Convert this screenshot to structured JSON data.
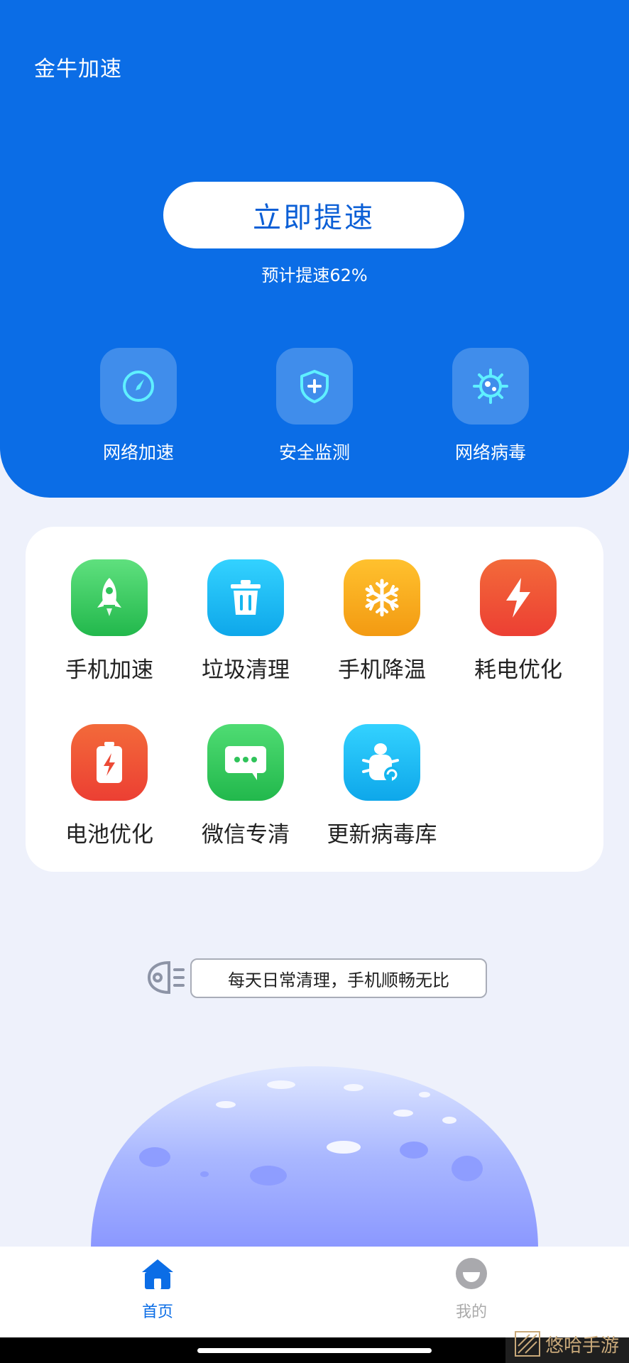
{
  "app": {
    "title": "金牛加速"
  },
  "boost": {
    "button_label": "立即提速",
    "estimate_text": "预计提速62%"
  },
  "quick_actions": [
    {
      "label": "网络加速",
      "icon": "compass-icon"
    },
    {
      "label": "安全监测",
      "icon": "shield-plus-icon"
    },
    {
      "label": "网络病毒",
      "icon": "virus-icon"
    }
  ],
  "tools": [
    {
      "label": "手机加速",
      "icon": "rocket-icon",
      "color": "#2fc35a"
    },
    {
      "label": "垃圾清理",
      "icon": "trash-icon",
      "color": "#14b6ef"
    },
    {
      "label": "手机降温",
      "icon": "snowflake-icon",
      "color": "#f7a41b"
    },
    {
      "label": "耗电优化",
      "icon": "lightning-icon",
      "color": "#f0503a"
    },
    {
      "label": "电池优化",
      "icon": "battery-icon",
      "color": "#f0503a"
    },
    {
      "label": "微信专清",
      "icon": "chat-icon",
      "color": "#2fc35a"
    },
    {
      "label": "更新病毒库",
      "icon": "bug-refresh-icon",
      "color": "#14b6ef"
    }
  ],
  "tip": {
    "text": "每天日常清理，手机顺畅无比"
  },
  "tabbar": {
    "home_label": "首页",
    "mine_label": "我的",
    "active_color": "#0b6de6",
    "inactive_color": "#aaaaaa"
  },
  "watermark": {
    "text": "悠哈手游"
  }
}
